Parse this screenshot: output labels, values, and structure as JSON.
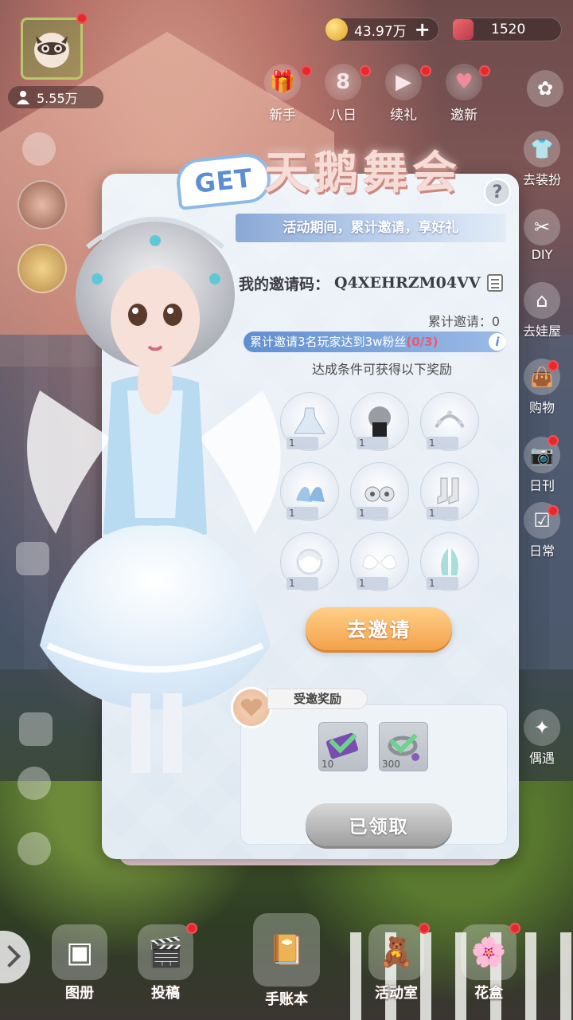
{
  "hud": {
    "fans": "5.55万",
    "coins": "43.97万",
    "gems": "1520"
  },
  "top_menu": [
    {
      "label": "新手",
      "icon": "gift-box-icon"
    },
    {
      "label": "八日",
      "icon": "eight-day-icon"
    },
    {
      "label": "续礼",
      "icon": "video-icon"
    },
    {
      "label": "邀新",
      "icon": "hearts-icon"
    }
  ],
  "right_menu": [
    {
      "label": "去装扮",
      "icon": "shirt-icon"
    },
    {
      "label": "DIY",
      "icon": "diy-icon"
    },
    {
      "label": "去娃屋",
      "icon": "house-icon"
    },
    {
      "label": "购物",
      "icon": "shopping-bag-icon"
    },
    {
      "label": "日刊",
      "icon": "camera-icon"
    },
    {
      "label": "日常",
      "icon": "checklist-icon"
    },
    {
      "label": "偶遇",
      "icon": "encounter-icon"
    }
  ],
  "event": {
    "badge": "GET",
    "title": "天鹅舞会",
    "help": "?",
    "ribbon": "活动期间，累计邀请，享好礼",
    "invite_code_label": "我的邀请码：",
    "invite_code": "Q4XEHRZM04VV",
    "total_invites": "累计邀请：0",
    "condition": "累计邀请3名玩家达到3w粉丝",
    "condition_progress": "(0/3)",
    "reward_hint": "达成条件可获得以下奖励",
    "rewards": [
      {
        "icon": "swan-dress-icon",
        "qty": "1"
      },
      {
        "icon": "hair-wig-icon",
        "qty": "1"
      },
      {
        "icon": "crown-headpiece-icon",
        "qty": "1"
      },
      {
        "icon": "blue-heels-icon",
        "qty": "1"
      },
      {
        "icon": "earrings-icon",
        "qty": "1"
      },
      {
        "icon": "socks-icon",
        "qty": "1"
      },
      {
        "icon": "feather-cuff-icon",
        "qty": "1"
      },
      {
        "icon": "angel-wings-icon",
        "qty": "1"
      },
      {
        "icon": "crystal-wings-icon",
        "qty": "1"
      }
    ],
    "invite_button": "去邀请",
    "invited_label": "受邀奖励",
    "invited_rewards": [
      {
        "icon": "ticket-icon",
        "qty": "10"
      },
      {
        "icon": "ring-item-icon",
        "qty": "300"
      }
    ],
    "claimed_button": "已领取"
  },
  "bottom_menu": [
    {
      "label": "图册",
      "icon": "album-icon"
    },
    {
      "label": "投稿",
      "icon": "film-icon"
    },
    {
      "label": "手账本",
      "icon": "journal-icon"
    },
    {
      "label": "活动室",
      "icon": "teddy-bear-icon"
    },
    {
      "label": "花盒",
      "icon": "flower-box-icon"
    }
  ]
}
